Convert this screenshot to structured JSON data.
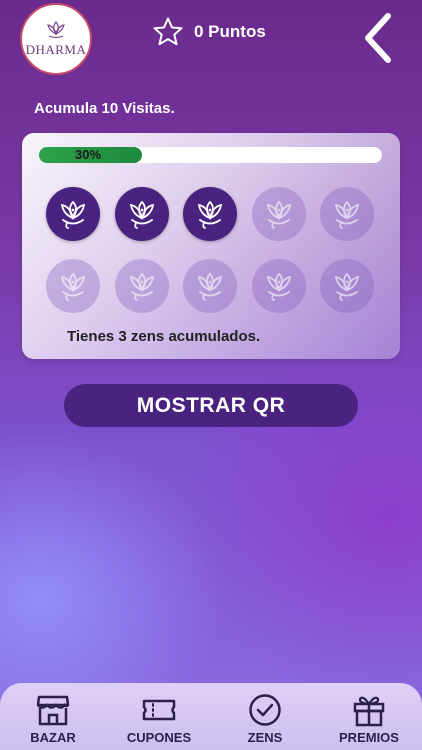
{
  "header": {
    "logo_text": "DHARMA",
    "points_text": "0 Puntos"
  },
  "visits": {
    "label": "Acumula 10 Visitas."
  },
  "progress": {
    "percent": 30,
    "label": "30%",
    "fill_color": "#2ea04a"
  },
  "stamps": {
    "total": 10,
    "filled": 3,
    "icon": "lotus-fish-icon"
  },
  "zens_text": "Tienes 3 zens acumulados.",
  "qr_button_label": "MOSTRAR QR",
  "tabs": [
    {
      "label": "BAZAR",
      "icon": "store-icon"
    },
    {
      "label": "CUPONES",
      "icon": "ticket-icon"
    },
    {
      "label": "ZENS",
      "icon": "check-circle-icon"
    },
    {
      "label": "PREMIOS",
      "icon": "gift-icon"
    }
  ],
  "colors": {
    "accent": "#4a2380",
    "progress_green": "#2ea04a",
    "tabbar": "#d8cbf2"
  }
}
